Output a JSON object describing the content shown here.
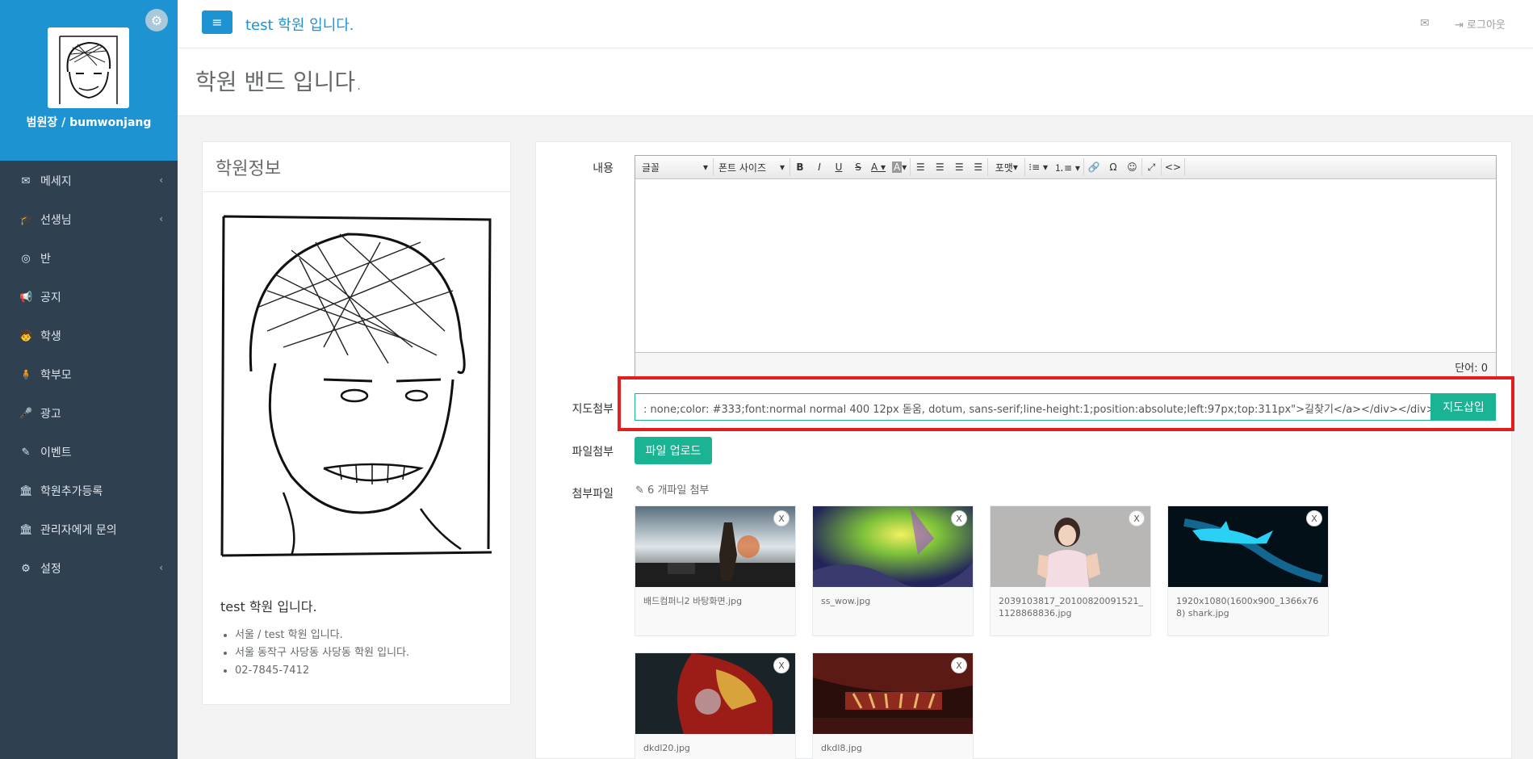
{
  "sidebar": {
    "profile_name": "범원장 / bumwonjang",
    "items": [
      {
        "label": "메세지",
        "icon": "envelope-icon",
        "has_chevron": true
      },
      {
        "label": "선생님",
        "icon": "graduation-cap-icon",
        "has_chevron": true
      },
      {
        "label": "반",
        "icon": "bullseye-icon",
        "has_chevron": false
      },
      {
        "label": "공지",
        "icon": "bullhorn-icon",
        "has_chevron": false
      },
      {
        "label": "학생",
        "icon": "child-icon",
        "has_chevron": false
      },
      {
        "label": "학부모",
        "icon": "male-icon",
        "has_chevron": false
      },
      {
        "label": "광고",
        "icon": "microphone-icon",
        "has_chevron": false
      },
      {
        "label": "이벤트",
        "icon": "magic-wand-icon",
        "has_chevron": false
      },
      {
        "label": "학원추가등록",
        "icon": "bank-icon",
        "has_chevron": false
      },
      {
        "label": "관리자에게 문의",
        "icon": "bank-icon",
        "has_chevron": false
      },
      {
        "label": "설정",
        "icon": "gear-icon",
        "has_chevron": true
      }
    ]
  },
  "topbar": {
    "title": "test 학원 입니다.",
    "logout_label": "로그아웃"
  },
  "page": {
    "heading": "학원 밴드 입니다."
  },
  "info_panel": {
    "title": "학원정보",
    "academy_name": "test 학원 입니다.",
    "details": [
      "서울 / test 학원 입니다.",
      "서울 동작구 사당동 사당동 학원 입니다.",
      "02-7845-7412"
    ]
  },
  "form": {
    "content_label": "내용",
    "toolbar": {
      "font_select": "글꼴",
      "size_select": "폰트 사이즈",
      "format_select": "포맷"
    },
    "word_count": "단어: 0",
    "map_label": "지도첨부",
    "map_value": ": none;color: #333;font:normal normal 400 12px 돋움, dotum, sans-serif;line-height:1;position:absolute;left:97px;top:311px\">길찾기</a></div></div>",
    "map_button": "지도삽입",
    "file_label": "파일첨부",
    "upload_button": "파일 업로드",
    "attached_label": "첨부파일",
    "attached_count": "6 개파일 첨부",
    "remove_label": "X",
    "files": [
      {
        "name": "배드컴퍼니2 바탕화면.jpg",
        "thumb": "battlefield"
      },
      {
        "name": "ss_wow.jpg",
        "thumb": "wow"
      },
      {
        "name": "2039103817_20100820091521_1128868836.jpg",
        "thumb": "girl"
      },
      {
        "name": "1920x1080(1600x900_1366x768) shark.jpg",
        "thumb": "shark"
      },
      {
        "name": "dkdl20.jpg",
        "thumb": "ironman"
      },
      {
        "name": "dkdl8.jpg",
        "thumb": "ironman3"
      }
    ]
  },
  "colors": {
    "accent": "#1d93d1",
    "sidebar_bg": "#2f4050",
    "success": "#1ab394",
    "highlight_border": "#e41d1d"
  }
}
